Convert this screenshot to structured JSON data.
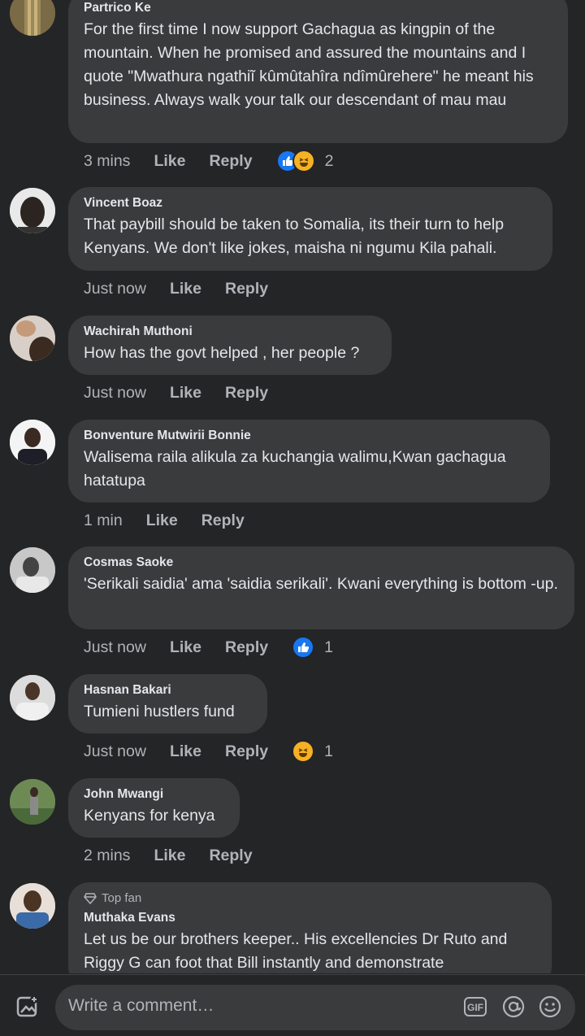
{
  "comments": [
    {
      "author": "Partrico Ke",
      "text": "For the first time I now support Gachagua as kingpin of the mountain. When he promised and assured the mountains and I quote \"Mwathura ngathiĩ kûmûtahîra ndîmûrehere\" he meant his business. Always walk your talk our descendant of mau mau",
      "time": "3 mins",
      "like": "Like",
      "reply": "Reply",
      "reaction_count": "2",
      "reactions": [
        "like-icon",
        "haha-icon"
      ]
    },
    {
      "author": "Vincent Boaz",
      "text": "That paybill should be taken to Somalia, its their turn to help Kenyans. We don't like jokes, maisha ni ngumu Kila pahali.",
      "time": "Just now",
      "like": "Like",
      "reply": "Reply"
    },
    {
      "author": "Wachirah Muthoni",
      "text": "How has the govt helped , her people ?",
      "time": "Just now",
      "like": "Like",
      "reply": "Reply"
    },
    {
      "author": "Bonventure Mutwirii Bonnie",
      "text": "Walisema raila alikula za kuchangia walimu,Kwan gachagua hatatupa",
      "time": "1 min",
      "like": "Like",
      "reply": "Reply"
    },
    {
      "author": "Cosmas Saoke",
      "text": "'Serikali saidia' ama 'saidia serikali'. Kwani everything is bottom -up.",
      "time": "Just now",
      "like": "Like",
      "reply": "Reply",
      "reaction_count": "1",
      "reactions": [
        "like-icon"
      ]
    },
    {
      "author": "Hasnan Bakari",
      "text": "Tumieni hustlers fund",
      "time": "Just now",
      "like": "Like",
      "reply": "Reply",
      "reaction_count": "1",
      "reactions": [
        "haha-icon"
      ]
    },
    {
      "author": "John Mwangi",
      "text": "Kenyans for kenya",
      "time": "2 mins",
      "like": "Like",
      "reply": "Reply"
    },
    {
      "badge": "Top fan",
      "author": "Muthaka Evans",
      "text": "Let us be our brothers keeper.. His excellencies Dr Ruto and Riggy G can foot that Bill instantly and demonstrate"
    }
  ],
  "composer": {
    "placeholder": "Write a comment…",
    "gif_label": "GIF"
  },
  "colors": {
    "background": "#242526",
    "bubble": "#3a3b3c",
    "primary_text": "#e4e6eb",
    "secondary_text": "#b0b3b8",
    "like_blue": "#1877f2",
    "haha_yellow": "#f7b125"
  }
}
